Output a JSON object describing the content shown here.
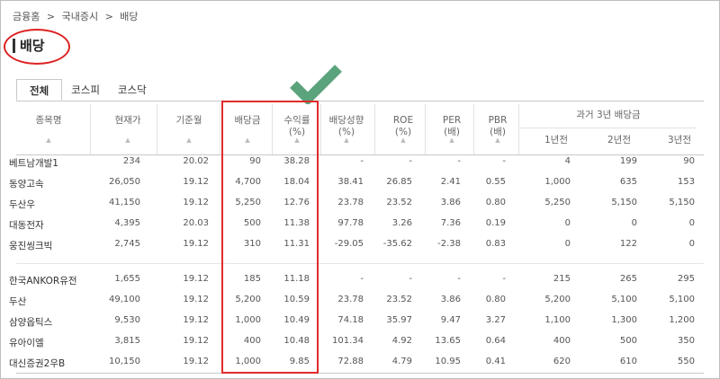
{
  "breadcrumb": [
    "금융홈",
    ">",
    "국내증시",
    ">",
    "배당"
  ],
  "page_title": "배당",
  "tabs": [
    "전체",
    "코스피",
    "코스닥"
  ],
  "columns": {
    "name": "종목명",
    "price": "현재가",
    "base_month": "기준월",
    "dividend": "배당금",
    "yield_1": "수익률",
    "yield_2": "(%)",
    "payout_1": "배당성향",
    "payout_2": "(%)",
    "roe_1": "ROE",
    "roe_2": "(%)",
    "per_1": "PER",
    "per_2": "(배)",
    "pbr_1": "PBR",
    "pbr_2": "(배)",
    "past_group": "과거 3년 배당금",
    "past_1": "1년전",
    "past_2": "2년전",
    "past_3": "3년전"
  },
  "sort_icon": "▲",
  "rows": [
    [
      "베트남개발1",
      "234",
      "20.02",
      "90",
      "38.28",
      "-",
      "-",
      "-",
      "-",
      "4",
      "199",
      "90"
    ],
    [
      "동양고속",
      "26,050",
      "19.12",
      "4,700",
      "18.04",
      "38.41",
      "26.85",
      "2.41",
      "0.55",
      "1,000",
      "635",
      "153"
    ],
    [
      "두산우",
      "41,150",
      "19.12",
      "5,250",
      "12.76",
      "23.78",
      "23.52",
      "3.86",
      "0.80",
      "5,250",
      "5,150",
      "5,150"
    ],
    [
      "대동전자",
      "4,395",
      "20.03",
      "500",
      "11.38",
      "97.78",
      "3.26",
      "7.36",
      "0.19",
      "0",
      "0",
      "0"
    ],
    [
      "웅진씽크빅",
      "2,745",
      "19.12",
      "310",
      "11.31",
      "-29.05",
      "-35.62",
      "-2.38",
      "0.83",
      "0",
      "122",
      "0"
    ],
    [
      "한국ANKOR유전",
      "1,655",
      "19.12",
      "185",
      "11.18",
      "-",
      "-",
      "-",
      "-",
      "215",
      "265",
      "295"
    ],
    [
      "두산",
      "49,100",
      "19.12",
      "5,200",
      "10.59",
      "23.78",
      "23.52",
      "3.86",
      "0.80",
      "5,200",
      "5,100",
      "5,100"
    ],
    [
      "삼양옵틱스",
      "9,530",
      "19.12",
      "1,000",
      "10.49",
      "74.18",
      "35.97",
      "9.47",
      "3.27",
      "1,100",
      "1,300",
      "1,200"
    ],
    [
      "유아이엘",
      "3,815",
      "19.12",
      "400",
      "10.48",
      "101.34",
      "4.92",
      "13.65",
      "0.64",
      "400",
      "500",
      "350"
    ],
    [
      "대신증권2우B",
      "10,150",
      "19.12",
      "1,000",
      "9.85",
      "72.88",
      "4.79",
      "10.95",
      "0.41",
      "620",
      "610",
      "550"
    ]
  ],
  "colors": {
    "highlight": "#e02b2b",
    "check": "#5aa37c"
  }
}
